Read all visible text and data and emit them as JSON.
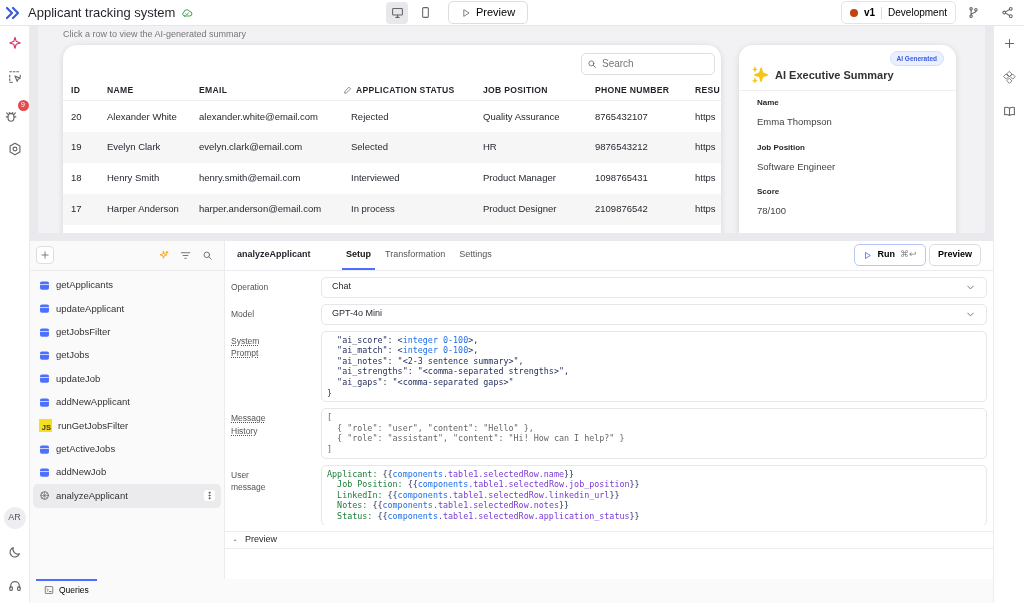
{
  "app": {
    "title": "Applicant tracking system",
    "preview_button": "Preview",
    "version": "v1",
    "environment": "Development"
  },
  "left_rail": {
    "badge": "9",
    "avatar": "AR"
  },
  "canvas": {
    "hint": "Click a row to view the AI-generated summary",
    "table": {
      "search_placeholder": "Search",
      "columns": [
        {
          "label": "ID",
          "editable": false
        },
        {
          "label": "NAME",
          "editable": false
        },
        {
          "label": "EMAIL",
          "editable": false
        },
        {
          "label": "APPLICATION STATUS",
          "editable": true
        },
        {
          "label": "JOB POSITION",
          "editable": false
        },
        {
          "label": "PHONE NUMBER",
          "editable": false
        },
        {
          "label": "RESU",
          "editable": false
        }
      ],
      "rows": [
        [
          "20",
          "Alexander White",
          "alexander.white@email.com",
          "Rejected",
          "Quality Assurance",
          "8765432107",
          "https"
        ],
        [
          "19",
          "Evelyn Clark",
          "evelyn.clark@email.com",
          "Selected",
          "HR",
          "9876543212",
          "https"
        ],
        [
          "18",
          "Henry Smith",
          "henry.smith@email.com",
          "Interviewed",
          "Product Manager",
          "1098765431",
          "https"
        ],
        [
          "17",
          "Harper Anderson",
          "harper.anderson@email.com",
          "In process",
          "Product Designer",
          "2109876542",
          "https"
        ]
      ]
    },
    "summary": {
      "title": "AI Executive Summary",
      "badge": "AI Generated",
      "fields": [
        {
          "label": "Name",
          "value": "Emma Thompson"
        },
        {
          "label": "Job Position",
          "value": "Software Engineer"
        },
        {
          "label": "Score",
          "value": "78/100"
        }
      ]
    }
  },
  "queries": {
    "items": [
      {
        "name": "getApplicants",
        "kind": "db",
        "selected": false
      },
      {
        "name": "updateApplicant",
        "kind": "db",
        "selected": false
      },
      {
        "name": "getJobsFilter",
        "kind": "db",
        "selected": false
      },
      {
        "name": "getJobs",
        "kind": "db",
        "selected": false
      },
      {
        "name": "updateJob",
        "kind": "db",
        "selected": false
      },
      {
        "name": "addNewApplicant",
        "kind": "db",
        "selected": false
      },
      {
        "name": "runGetJobsFilter",
        "kind": "js",
        "js_label": "JS",
        "selected": false
      },
      {
        "name": "getActiveJobs",
        "kind": "db",
        "selected": false
      },
      {
        "name": "addNewJob",
        "kind": "db",
        "selected": false
      },
      {
        "name": "analyzeApplicant",
        "kind": "ai",
        "selected": true
      }
    ],
    "bottom_tab": "Queries"
  },
  "editor": {
    "query_name": "analyzeApplicant",
    "tabs": [
      {
        "label": "Setup",
        "selected": true
      },
      {
        "label": "Transformation",
        "selected": false
      },
      {
        "label": "Settings",
        "selected": false
      }
    ],
    "run_button": "Run",
    "run_shortcut": "⌘↩",
    "preview_button": "Preview",
    "fields": [
      {
        "label": "Operation",
        "kind": "select",
        "value": "Chat"
      },
      {
        "label": "Model",
        "kind": "select",
        "value": "GPT-4o Mini"
      },
      {
        "label": "System Prompt",
        "kind": "code",
        "lines": [
          [
            {
              "t": "  \"ai_score\": <",
              "kind": "plain"
            },
            {
              "t": "integer 0-100",
              "kind": "type"
            },
            {
              "t": ">,",
              "kind": "plain"
            }
          ],
          [
            {
              "t": "  \"ai_match\": <",
              "kind": "plain"
            },
            {
              "t": "integer 0-100",
              "kind": "type"
            },
            {
              "t": ">,",
              "kind": "plain"
            }
          ],
          [
            {
              "t": "  \"ai_notes\": \"<2-3 sentence summary>\",",
              "kind": "plain"
            }
          ],
          [
            {
              "t": "  \"ai_strengths\": \"<comma-separated strengths>\",",
              "kind": "plain"
            }
          ],
          [
            {
              "t": "  \"ai_gaps\": \"<comma-separated gaps>\"",
              "kind": "plain"
            }
          ],
          [
            {
              "t": "}",
              "kind": "plain"
            }
          ]
        ]
      },
      {
        "label": "Message History",
        "kind": "code",
        "lines": [
          [
            {
              "t": "[",
              "kind": "muted"
            }
          ],
          [
            {
              "t": "  { \"role\": \"user\", \"content\": \"Hello\" },",
              "kind": "muted"
            }
          ],
          [
            {
              "t": "  { \"role\": \"assistant\", \"content\": \"Hi! How can I help?\" }",
              "kind": "muted"
            }
          ],
          [
            {
              "t": "]",
              "kind": "muted"
            }
          ]
        ]
      },
      {
        "label": "User message",
        "kind": "code",
        "lines": [
          [
            {
              "t": "Applicant: ",
              "kind": "key"
            },
            {
              "t": "{{",
              "kind": "plain"
            },
            {
              "t": "components",
              "kind": "type"
            },
            {
              "t": ".table1.selectedRow.name",
              "kind": "path"
            },
            {
              "t": "}}",
              "kind": "plain"
            }
          ],
          [
            {
              "t": "  Job Position: ",
              "kind": "key"
            },
            {
              "t": "{{",
              "kind": "plain"
            },
            {
              "t": "components",
              "kind": "type"
            },
            {
              "t": ".table1.selectedRow.job_position",
              "kind": "path"
            },
            {
              "t": "}}",
              "kind": "plain"
            }
          ],
          [
            {
              "t": "  LinkedIn: ",
              "kind": "key"
            },
            {
              "t": "{{",
              "kind": "plain"
            },
            {
              "t": "components",
              "kind": "type"
            },
            {
              "t": ".table1.selectedRow.linkedin_url",
              "kind": "path"
            },
            {
              "t": "}}",
              "kind": "plain"
            }
          ],
          [
            {
              "t": "  Notes: ",
              "kind": "key"
            },
            {
              "t": "{{",
              "kind": "plain"
            },
            {
              "t": "components",
              "kind": "type"
            },
            {
              "t": ".table1.selectedRow.notes",
              "kind": "path"
            },
            {
              "t": "}}",
              "kind": "plain"
            }
          ],
          [
            {
              "t": "  Status: ",
              "kind": "key"
            },
            {
              "t": "{{",
              "kind": "plain"
            },
            {
              "t": "components",
              "kind": "type"
            },
            {
              "t": ".table1.selectedRow.application_status",
              "kind": "path"
            },
            {
              "t": "}}",
              "kind": "plain"
            }
          ]
        ]
      }
    ],
    "preview_label": "Preview"
  }
}
